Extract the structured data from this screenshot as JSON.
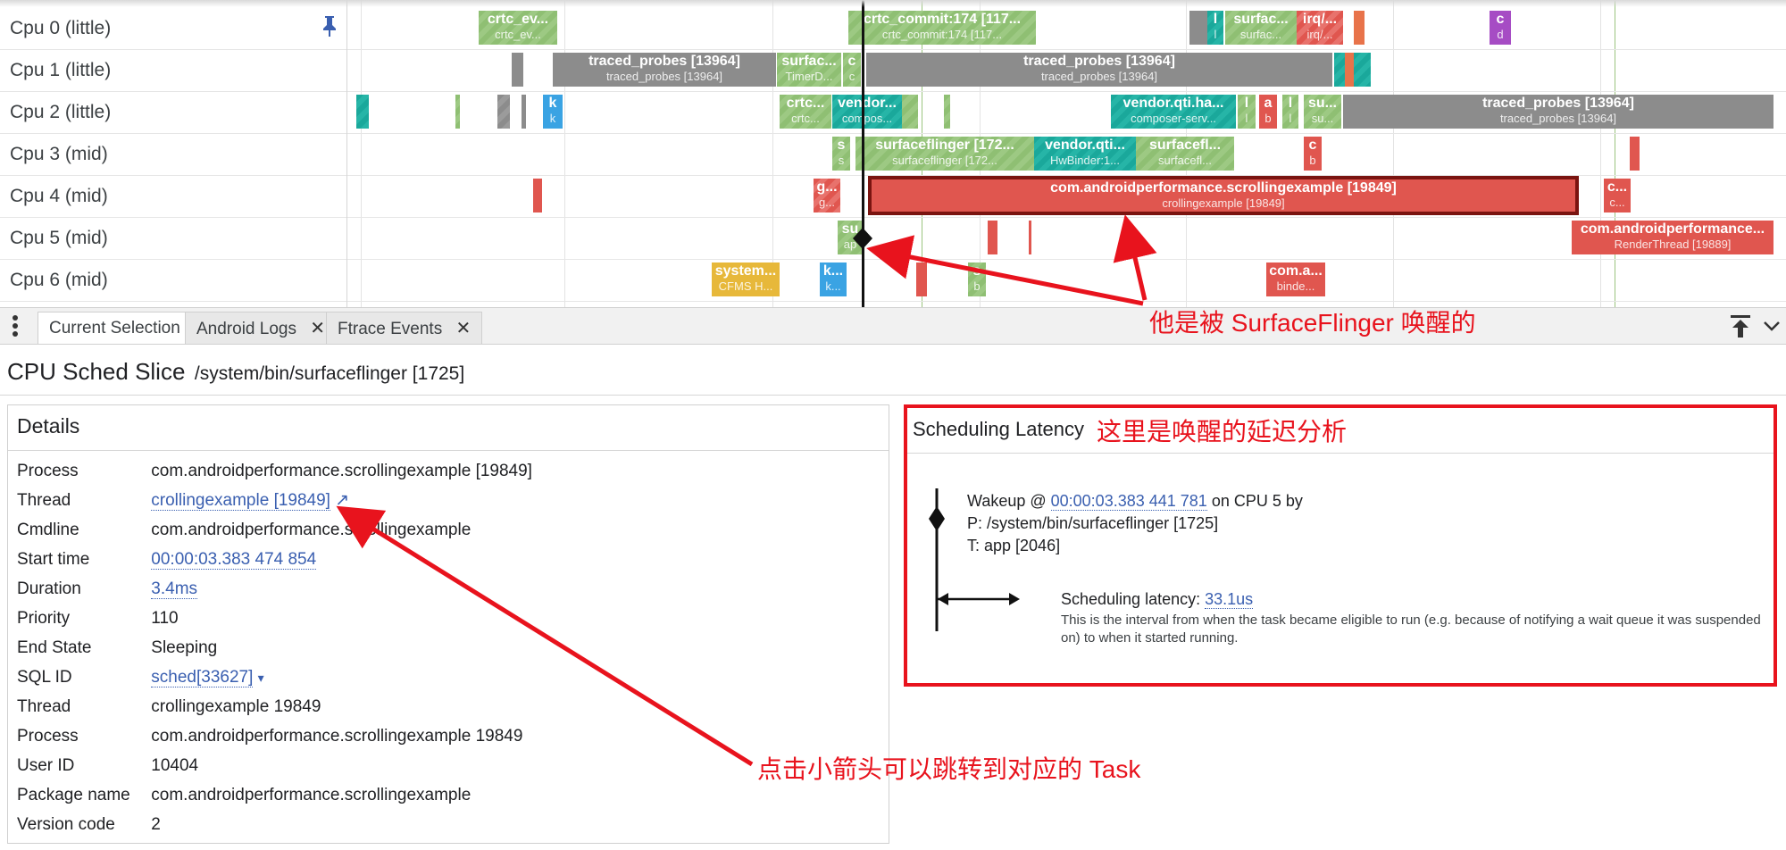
{
  "timeline": {
    "cpus": [
      "Cpu 0 (little)",
      "Cpu 1 (little)",
      "Cpu 2 (little)",
      "Cpu 3 (mid)",
      "Cpu 4 (mid)",
      "Cpu 5 (mid)",
      "Cpu 6 (mid)"
    ],
    "slices": {
      "c0_crtc_ev": [
        "crtc_ev...",
        "crtc_ev..."
      ],
      "c0_crtc_commit": [
        "crtc_commit:174 [117...",
        "crtc_commit:174 [117..."
      ],
      "c0_l": [
        "l",
        "l"
      ],
      "c0_surfac": [
        "surfac...",
        "surfac..."
      ],
      "c0_irq": [
        "irq/...",
        "irq/..."
      ],
      "c0_c": [
        "c",
        "d"
      ],
      "c1_traced": [
        "traced_probes [13964]",
        "traced_probes [13964]"
      ],
      "c1_surfac": [
        "surfac...",
        "TimerD..."
      ],
      "c1_c": [
        "c",
        "c"
      ],
      "c1_traced2": [
        "traced_probes [13964]",
        "traced_probes [13964]"
      ],
      "c2_k": [
        "k",
        "k"
      ],
      "c2_crtc": [
        "crtc...",
        "crtc..."
      ],
      "c2_vendor": [
        "vendor...",
        "compos..."
      ],
      "c2_vendorqti": [
        "vendor.qti.ha...",
        "composer-serv..."
      ],
      "c2_l1": [
        "l",
        "l"
      ],
      "c2_a": [
        "a",
        "b"
      ],
      "c2_l2": [
        "l",
        "l"
      ],
      "c2_su": [
        "su...",
        "su..."
      ],
      "c2_traced": [
        "traced_probes [13964]",
        "traced_probes [13964]"
      ],
      "c3_s": [
        "s",
        "s"
      ],
      "c3_surfaceflinger": [
        "surfaceflinger [172...",
        "surfaceflinger [172..."
      ],
      "c3_vendorqti": [
        "vendor.qti...",
        "HwBinder:1..."
      ],
      "c3_surfacefl": [
        "surfacefl...",
        "surfacefl..."
      ],
      "c3_c": [
        "c",
        "b"
      ],
      "c4_g": [
        "g...",
        "g..."
      ],
      "c4_main": [
        "com.androidperformance.scrollingexample [19849]",
        "crollingexample [19849]"
      ],
      "c4_c": [
        "c...",
        "c..."
      ],
      "c5_su": [
        "su",
        "ap"
      ],
      "c5_com": [
        "com.androidperformance...",
        "RenderThread [19889]"
      ],
      "c6_system": [
        "system...",
        "CFMS H..."
      ],
      "c6_k": [
        "k...",
        "k..."
      ],
      "c6_s": [
        "s",
        "b"
      ],
      "c6_com": [
        "com.a...",
        "binde..."
      ]
    }
  },
  "tabs": {
    "current_selection": "Current Selection",
    "android_logs": "Android Logs",
    "ftrace_events": "Ftrace Events",
    "close_glyph": "✕"
  },
  "header": {
    "title": "CPU Sched Slice",
    "subtitle": "/system/bin/surfaceflinger [1725]"
  },
  "details": {
    "title": "Details",
    "rows": [
      {
        "key": "Process",
        "value": "com.androidperformance.scrollingexample [19849]"
      },
      {
        "key": "Thread",
        "value": "crollingexample [19849]",
        "link_glyph": "↗"
      },
      {
        "key": "Cmdline",
        "value": "com.androidperformance.scrollingexample"
      },
      {
        "key": "Start time",
        "value": "00:00:03.383 474 854"
      },
      {
        "key": "Duration",
        "value": "3.4ms"
      },
      {
        "key": "Priority",
        "value": "110"
      },
      {
        "key": "End State",
        "value": "Sleeping"
      },
      {
        "key": "SQL ID",
        "value": "sched[33627]",
        "dropdown_glyph": "▾"
      },
      {
        "key": "Thread",
        "value": "crollingexample 19849"
      },
      {
        "key": "Process",
        "value": "com.androidperformance.scrollingexample 19849"
      },
      {
        "key": "User ID",
        "value": "10404"
      },
      {
        "key": "Package name",
        "value": "com.androidperformance.scrollingexample"
      },
      {
        "key": "Version code",
        "value": "2"
      }
    ]
  },
  "latency": {
    "title": "Scheduling Latency",
    "wakeup_prefix": "Wakeup @ ",
    "wakeup_time": "00:00:03.383 441 781",
    "wakeup_suffix": " on CPU 5 by",
    "process": "P: /system/bin/surfaceflinger [1725]",
    "thread": "T: app [2046]",
    "latency_label": "Scheduling latency: ",
    "latency_value": "33.1us",
    "note_line1": "This is the interval from when the task became eligible to run (e.g. because of notifying a wait queue it was suspended",
    "note_line2": "on) to when it started running."
  },
  "annotations": {
    "woken_by": "他是被 SurfaceFlinger 唤醒的",
    "latency_analysis": "这里是唤醒的延迟分析",
    "click_arrow": "点击小箭头可以跳转到对应的 Task"
  },
  "colors": {
    "annotation_red": "#e8131d",
    "link_blue": "#3a5fb0",
    "slice_green": "#8fbf73",
    "slice_teal": "#1aa89b",
    "slice_gray": "#8c8c8c",
    "slice_red": "#e0564f"
  }
}
